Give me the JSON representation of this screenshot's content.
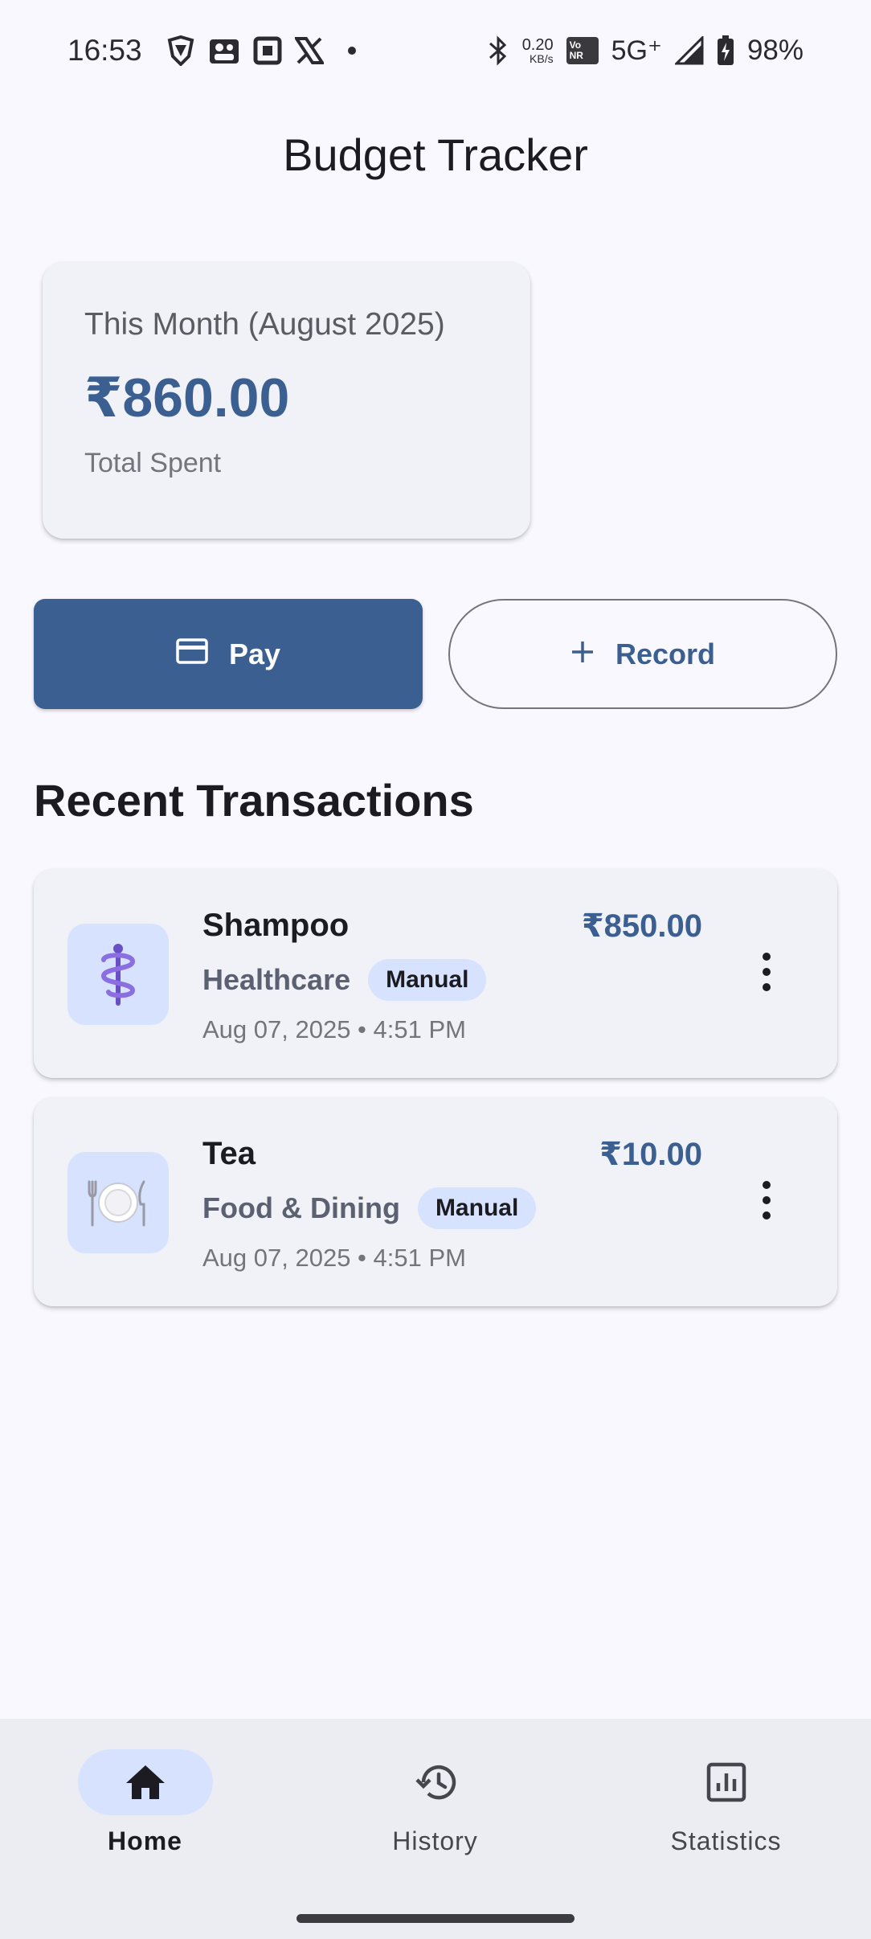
{
  "status_bar": {
    "time": "16:53",
    "speed_value": "0.20",
    "speed_unit": "KB/s",
    "vonr_top": "Vo",
    "vonr_bottom": "NR",
    "network": "5G⁺",
    "battery": "98%"
  },
  "app": {
    "title": "Budget Tracker"
  },
  "summary": {
    "label": "This Month (August 2025)",
    "amount": "₹860.00",
    "sublabel": "Total Spent"
  },
  "actions": {
    "pay_label": "Pay",
    "record_label": "Record"
  },
  "recent": {
    "heading": "Recent Transactions",
    "items": [
      {
        "name": "Shampoo",
        "amount": "₹850.00",
        "category": "Healthcare",
        "badge": "Manual",
        "date": "Aug 07, 2025 • 4:51 PM",
        "icon": "medical-icon"
      },
      {
        "name": "Tea",
        "amount": "₹10.00",
        "category": "Food & Dining",
        "badge": "Manual",
        "date": "Aug 07, 2025 • 4:51 PM",
        "icon": "plate-icon"
      }
    ]
  },
  "nav": {
    "items": [
      {
        "label": "Home",
        "icon": "home-icon",
        "active": true
      },
      {
        "label": "History",
        "icon": "history-icon",
        "active": false
      },
      {
        "label": "Statistics",
        "icon": "statistics-icon",
        "active": false
      }
    ]
  },
  "colors": {
    "primary": "#3a5f90",
    "background": "#f8f8fe",
    "card": "#f1f2f8",
    "badge": "#d7e3fe"
  }
}
